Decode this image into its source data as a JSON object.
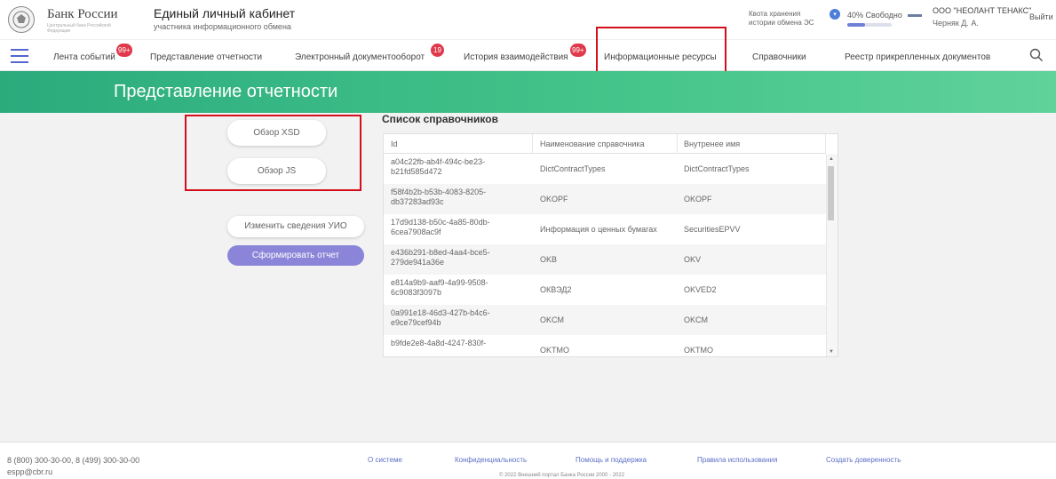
{
  "header": {
    "bank_name": "Банк России",
    "bank_sub": "Центральный банк Российской Федерации",
    "cabinet_title": "Единый личный кабинет",
    "cabinet_sub": "участника информационного обмена",
    "quota_line1": "Квота хранения",
    "quota_line2": "истории обмена ЭС",
    "quota_free": "40% Свободно",
    "quota_free_fraction": 0.4,
    "org_name": "ООО \"НЕОЛАНТ ТЕНАКС\"",
    "org_user": "Черняк Д. А.",
    "logout": "Выйти"
  },
  "nav": {
    "items": [
      {
        "label": "Лента событий",
        "badge": "99+"
      },
      {
        "label": "Представление отчетности",
        "badge": ""
      },
      {
        "label": "Электронный документооборот",
        "badge": "19"
      },
      {
        "label": "История взаимодействия",
        "badge": "99+"
      },
      {
        "label": "Информационные ресурсы",
        "badge": ""
      },
      {
        "label": "Справочники",
        "badge": ""
      },
      {
        "label": "Реестр прикрепленных документов",
        "badge": ""
      }
    ]
  },
  "page_title": "Представление отчетности",
  "left": {
    "xsd_button": "Обзор XSD",
    "js_button": "Обзор JS",
    "edit_button": "Изменить сведения УИО",
    "generate_button": "Сформировать отчет"
  },
  "table": {
    "title": "Список справочников",
    "columns": [
      "Id",
      "Наименование справочника",
      "Внутренее имя"
    ],
    "rows": [
      {
        "id": "a04c22fb-ab4f-494c-be23-b21fd585d472",
        "name": "DictContractTypes",
        "internal": "DictContractTypes"
      },
      {
        "id": "f58f4b2b-b53b-4083-8205-db37283ad93c",
        "name": "OKOPF",
        "internal": "OKOPF"
      },
      {
        "id": "17d9d138-b50c-4a85-80db-6cea7908ac9f",
        "name": "Информация о ценных бумагах",
        "internal": "SecuritiesEPVV"
      },
      {
        "id": "e436b291-b8ed-4aa4-bce5-279de941a36e",
        "name": "OKB",
        "internal": "OKV"
      },
      {
        "id": "e814a9b9-aaf9-4a99-9508-6c9083f3097b",
        "name": "ОКВЭД2",
        "internal": "OKVED2"
      },
      {
        "id": "0a991e18-46d3-427b-b4c6-e9ce79cef94b",
        "name": "OKCM",
        "internal": "OKCM"
      },
      {
        "id": "b9fde2e8-4a8d-4247-830f-",
        "name": "OKTMO",
        "internal": "OKTMO"
      }
    ]
  },
  "footer": {
    "phone": "8 (800) 300-30-00, 8 (499) 300-30-00",
    "email": "espp@cbr.ru",
    "links": [
      "О системе",
      "Конфиденциальность",
      "Помощь и поддержка",
      "Правила использования",
      "Создать доверенность"
    ],
    "copyright": "© 2022 Внешний портал Банка России 2000 - 2022"
  }
}
